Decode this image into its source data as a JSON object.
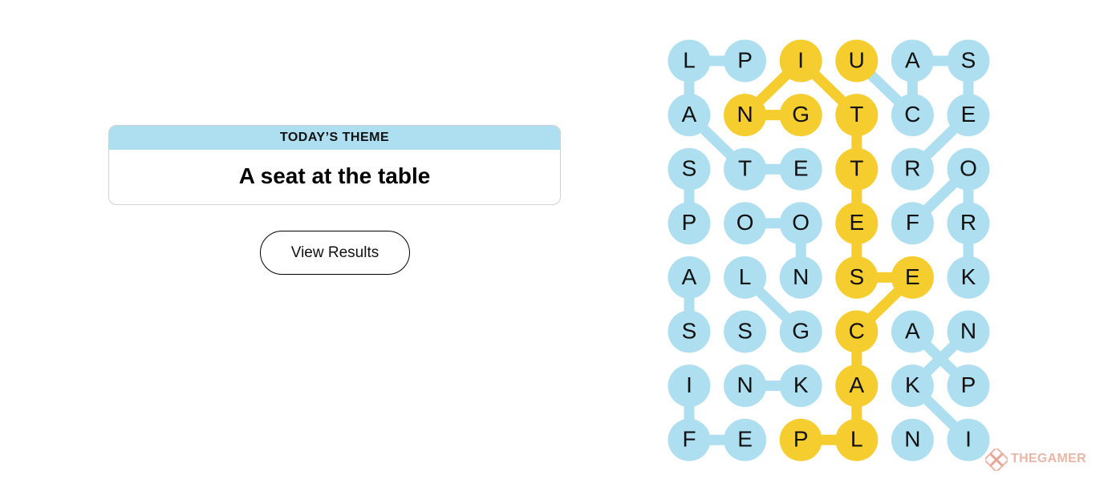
{
  "theme": {
    "header": "TODAY’S THEME",
    "title": "A seat at the table"
  },
  "actions": {
    "view_results_label": "View Results"
  },
  "colors": {
    "found": "#aedff0",
    "spangram": "#f6cd2e",
    "text": "#111111"
  },
  "grid": {
    "rows": 8,
    "cols": 6,
    "letters": [
      [
        "L",
        "P",
        "I",
        "U",
        "A",
        "S"
      ],
      [
        "A",
        "N",
        "G",
        "T",
        "C",
        "E"
      ],
      [
        "S",
        "T",
        "E",
        "T",
        "R",
        "O"
      ],
      [
        "P",
        "O",
        "O",
        "E",
        "F",
        "R"
      ],
      [
        "A",
        "L",
        "N",
        "S",
        "E",
        "K"
      ],
      [
        "S",
        "S",
        "G",
        "C",
        "A",
        "N"
      ],
      [
        "I",
        "N",
        "K",
        "A",
        "K",
        "P"
      ],
      [
        "F",
        "E",
        "P",
        "L",
        "N",
        "I"
      ]
    ],
    "spangram_cells": [
      [
        0,
        2
      ],
      [
        1,
        1
      ],
      [
        1,
        2
      ],
      [
        0,
        3
      ],
      [
        1,
        3
      ],
      [
        2,
        3
      ],
      [
        3,
        3
      ],
      [
        4,
        3
      ],
      [
        4,
        4
      ],
      [
        5,
        3
      ],
      [
        6,
        3
      ],
      [
        7,
        3
      ],
      [
        7,
        2
      ]
    ],
    "connections": [
      {
        "color": "found",
        "from": [
          0,
          0
        ],
        "to": [
          0,
          1
        ]
      },
      {
        "color": "found",
        "from": [
          0,
          0
        ],
        "to": [
          1,
          0
        ]
      },
      {
        "color": "found",
        "from": [
          1,
          0
        ],
        "to": [
          2,
          1
        ]
      },
      {
        "color": "found",
        "from": [
          2,
          1
        ],
        "to": [
          2,
          2
        ]
      },
      {
        "color": "found",
        "from": [
          0,
          4
        ],
        "to": [
          0,
          5
        ]
      },
      {
        "color": "found",
        "from": [
          0,
          3
        ],
        "to": [
          1,
          4
        ]
      },
      {
        "color": "found",
        "from": [
          1,
          4
        ],
        "to": [
          0,
          4
        ]
      },
      {
        "color": "found",
        "from": [
          0,
          5
        ],
        "to": [
          1,
          5
        ]
      },
      {
        "color": "found",
        "from": [
          1,
          5
        ],
        "to": [
          2,
          4
        ]
      },
      {
        "color": "found",
        "from": [
          2,
          0
        ],
        "to": [
          3,
          0
        ]
      },
      {
        "color": "found",
        "from": [
          3,
          1
        ],
        "to": [
          3,
          2
        ]
      },
      {
        "color": "found",
        "from": [
          3,
          2
        ],
        "to": [
          4,
          2
        ]
      },
      {
        "color": "found",
        "from": [
          3,
          4
        ],
        "to": [
          2,
          5
        ]
      },
      {
        "color": "found",
        "from": [
          2,
          5
        ],
        "to": [
          3,
          5
        ]
      },
      {
        "color": "found",
        "from": [
          3,
          5
        ],
        "to": [
          4,
          5
        ]
      },
      {
        "color": "found",
        "from": [
          4,
          0
        ],
        "to": [
          5,
          0
        ]
      },
      {
        "color": "found",
        "from": [
          4,
          1
        ],
        "to": [
          5,
          2
        ]
      },
      {
        "color": "found",
        "from": [
          5,
          4
        ],
        "to": [
          6,
          5
        ]
      },
      {
        "color": "found",
        "from": [
          5,
          5
        ],
        "to": [
          6,
          4
        ]
      },
      {
        "color": "found",
        "from": [
          6,
          4
        ],
        "to": [
          7,
          5
        ]
      },
      {
        "color": "found",
        "from": [
          6,
          1
        ],
        "to": [
          6,
          2
        ]
      },
      {
        "color": "found",
        "from": [
          6,
          0
        ],
        "to": [
          7,
          0
        ]
      },
      {
        "color": "found",
        "from": [
          7,
          0
        ],
        "to": [
          7,
          1
        ]
      },
      {
        "color": "spangram",
        "from": [
          1,
          1
        ],
        "to": [
          1,
          2
        ]
      },
      {
        "color": "spangram",
        "from": [
          1,
          1
        ],
        "to": [
          0,
          2
        ]
      },
      {
        "color": "spangram",
        "from": [
          0,
          2
        ],
        "to": [
          1,
          3
        ]
      },
      {
        "color": "spangram",
        "from": [
          1,
          3
        ],
        "to": [
          2,
          3
        ]
      },
      {
        "color": "spangram",
        "from": [
          2,
          3
        ],
        "to": [
          3,
          3
        ]
      },
      {
        "color": "spangram",
        "from": [
          3,
          3
        ],
        "to": [
          4,
          3
        ]
      },
      {
        "color": "spangram",
        "from": [
          4,
          3
        ],
        "to": [
          4,
          4
        ]
      },
      {
        "color": "spangram",
        "from": [
          4,
          4
        ],
        "to": [
          5,
          3
        ]
      },
      {
        "color": "spangram",
        "from": [
          5,
          3
        ],
        "to": [
          6,
          3
        ]
      },
      {
        "color": "spangram",
        "from": [
          6,
          3
        ],
        "to": [
          7,
          3
        ]
      },
      {
        "color": "spangram",
        "from": [
          7,
          3
        ],
        "to": [
          7,
          2
        ]
      }
    ]
  },
  "watermark": {
    "text": "THEGAMER",
    "icon": "thegamer-logo-icon"
  }
}
